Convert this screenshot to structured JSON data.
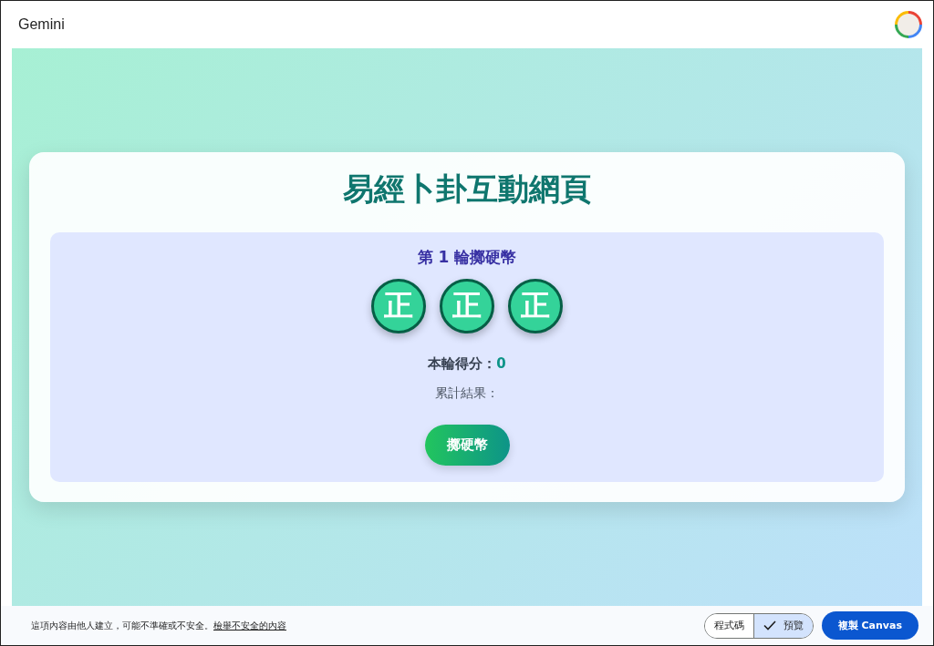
{
  "app": {
    "title": "Gemini"
  },
  "preview": {
    "title": "易經卜卦互動網頁",
    "round_title": "第 1 輪擲硬幣",
    "coins": [
      {
        "face": "正"
      },
      {
        "face": "正"
      },
      {
        "face": "正"
      }
    ],
    "score_label": "本輪得分：",
    "score_value": "0",
    "cumulative_label": "累計結果：",
    "toss_button": "擲硬幣"
  },
  "footer": {
    "notice": "這項內容由他人建立，可能不準確或不安全。",
    "report_link": "檢舉不安全的內容",
    "view_toggle": [
      {
        "label": "程式碼",
        "selected": false
      },
      {
        "label": "預覽",
        "selected": true
      }
    ],
    "copy_button": "複製 Canvas"
  }
}
